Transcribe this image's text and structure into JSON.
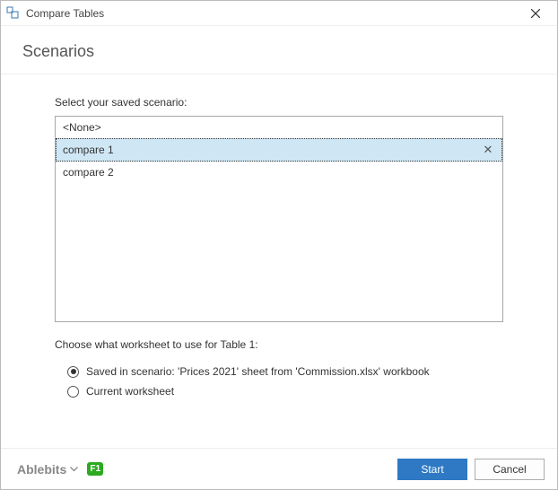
{
  "window": {
    "title": "Compare Tables"
  },
  "header": {
    "title": "Scenarios"
  },
  "scenario": {
    "label": "Select your saved scenario:",
    "items": [
      {
        "label": "<None>",
        "selected": false
      },
      {
        "label": "compare 1",
        "selected": true
      },
      {
        "label": "compare 2",
        "selected": false
      }
    ]
  },
  "worksheet": {
    "label": "Choose what worksheet to use for Table 1:",
    "options": {
      "saved": {
        "label": "Saved in scenario: 'Prices 2021' sheet from 'Commission.xlsx' workbook",
        "checked": true
      },
      "current": {
        "label": "Current worksheet",
        "checked": false
      }
    }
  },
  "footer": {
    "brand": "Ablebits",
    "help": "F1",
    "start": "Start",
    "cancel": "Cancel"
  }
}
